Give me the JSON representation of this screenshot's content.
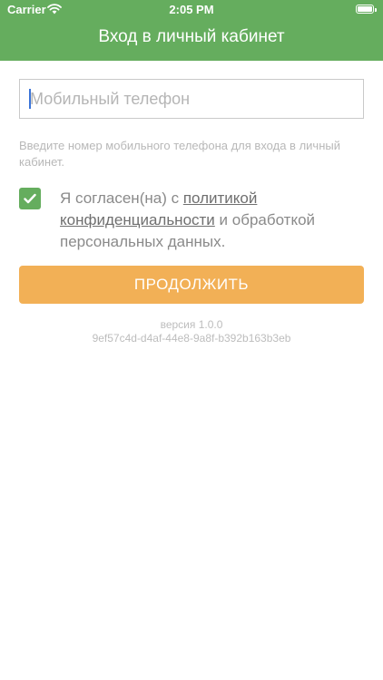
{
  "colors": {
    "brand": "#65ad5e",
    "accent": "#f2b056"
  },
  "status_bar": {
    "carrier": "Carrier",
    "time": "2:05 PM",
    "icons": [
      "wifi-icon",
      "battery-icon"
    ]
  },
  "header": {
    "title": "Вход в личный кабинет"
  },
  "phone": {
    "value": "",
    "placeholder": "Мобильный телефон"
  },
  "hint": "Введите номер мобильного телефона для входа в личный кабинет.",
  "consent": {
    "checked": true,
    "text_before": "Я согласен(на) с ",
    "link_label": "политикой конфиденциальности",
    "text_after": " и обработкой персональных данных.",
    "icon": "checkmark-icon"
  },
  "continue_label": "ПРОДОЛЖИТЬ",
  "footer": {
    "version": "версия 1.0.0",
    "build_id": "9ef57c4d-d4af-44e8-9a8f-b392b163b3eb"
  }
}
